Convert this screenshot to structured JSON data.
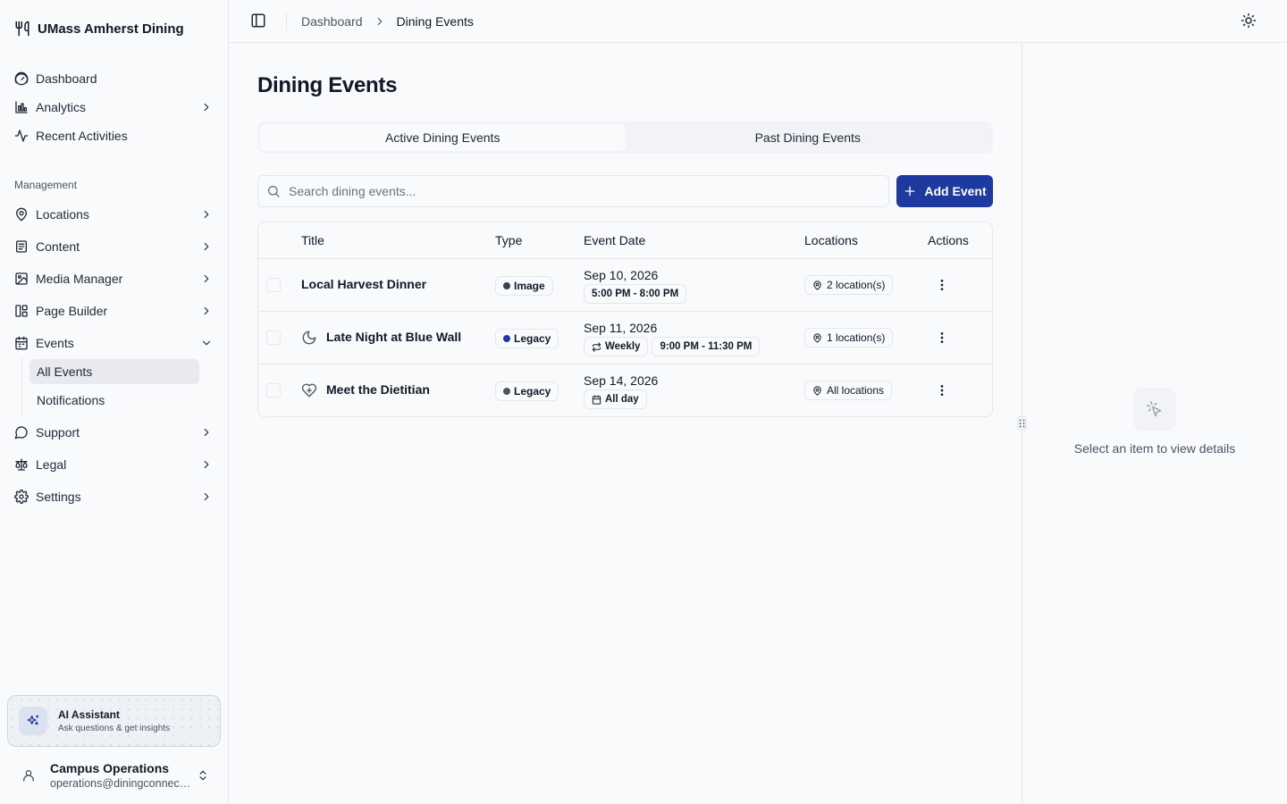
{
  "brand": {
    "name": "UMass Amherst Dining"
  },
  "nav": {
    "dashboard": "Dashboard",
    "analytics": "Analytics",
    "recent": "Recent Activities",
    "section_label": "Management",
    "locations": "Locations",
    "content": "Content",
    "media": "Media Manager",
    "page_builder": "Page Builder",
    "events": "Events",
    "all_events": "All Events",
    "notifications": "Notifications",
    "support": "Support",
    "legal": "Legal",
    "settings": "Settings"
  },
  "ai": {
    "title": "AI Assistant",
    "subtitle": "Ask questions & get insights"
  },
  "user": {
    "name": "Campus Operations",
    "email": "operations@diningconnect.c..."
  },
  "breadcrumb": {
    "parent": "Dashboard",
    "current": "Dining Events"
  },
  "page": {
    "title": "Dining Events"
  },
  "tabs": {
    "active": "Active Dining Events",
    "past": "Past Dining Events"
  },
  "search": {
    "placeholder": "Search dining events..."
  },
  "add_button": "Add Event",
  "table": {
    "headers": {
      "title": "Title",
      "type": "Type",
      "date": "Event Date",
      "locations": "Locations",
      "actions": "Actions"
    },
    "rows": [
      {
        "title": "Local Harvest Dinner",
        "type": "Image",
        "type_color": "#374151",
        "date": "Sep 10, 2026",
        "time": "5:00 PM - 8:00 PM",
        "locations": "2 location(s)"
      },
      {
        "title": "Late Night at Blue Wall",
        "type": "Legacy",
        "type_color": "#1e3a9e",
        "date": "Sep 11, 2026",
        "recurrence": "Weekly",
        "time": "9:00 PM - 11:30 PM",
        "locations": "1 location(s)"
      },
      {
        "title": "Meet the Dietitian",
        "type": "Legacy",
        "type_color": "#4b5563",
        "date": "Sep 14, 2026",
        "time": "All day",
        "locations": "All locations"
      }
    ]
  },
  "detail": {
    "empty": "Select an item to view details"
  },
  "colors": {
    "accent": "#1e3a9e",
    "border": "#e5e7eb",
    "background": "#f8fafc"
  }
}
